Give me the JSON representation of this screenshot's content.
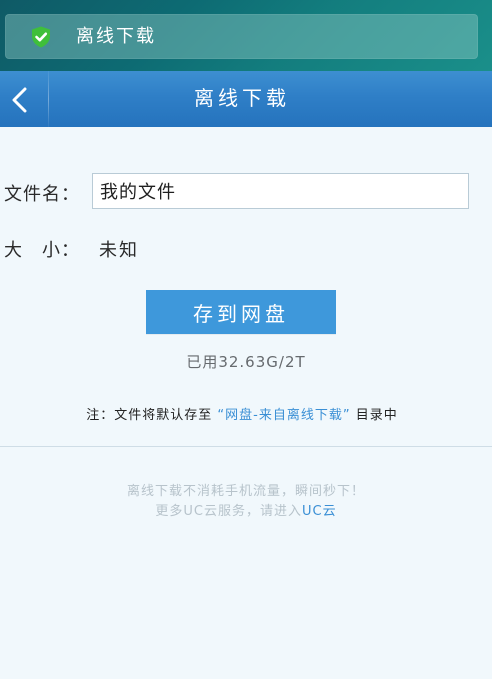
{
  "notification": {
    "text": "离线下载",
    "icon": "check-shield-icon",
    "icon_color": "#3fbf3a"
  },
  "header": {
    "title": "离线下载",
    "back_icon": "chevron-left-icon",
    "background": "#2f7fc7"
  },
  "form": {
    "filename_label": "文件名：",
    "filename_value": "我的文件",
    "size_label": "大  小：",
    "size_value": "未知"
  },
  "save_button": {
    "label": "存到网盘",
    "color": "#3e98db"
  },
  "usage": {
    "text": "已用32.63G/2T"
  },
  "note": {
    "prefix": "注：文件将默认存至",
    "path": "“网盘-来自离线下载”",
    "suffix": "目录中"
  },
  "footer": {
    "line1": "离线下载不消耗手机流量，瞬间秒下！",
    "line2_prefix": "更多UC云服务，请进入",
    "line2_link": "UC云"
  },
  "colors": {
    "link": "#3a8fd5",
    "background": "#f1f8fc"
  }
}
